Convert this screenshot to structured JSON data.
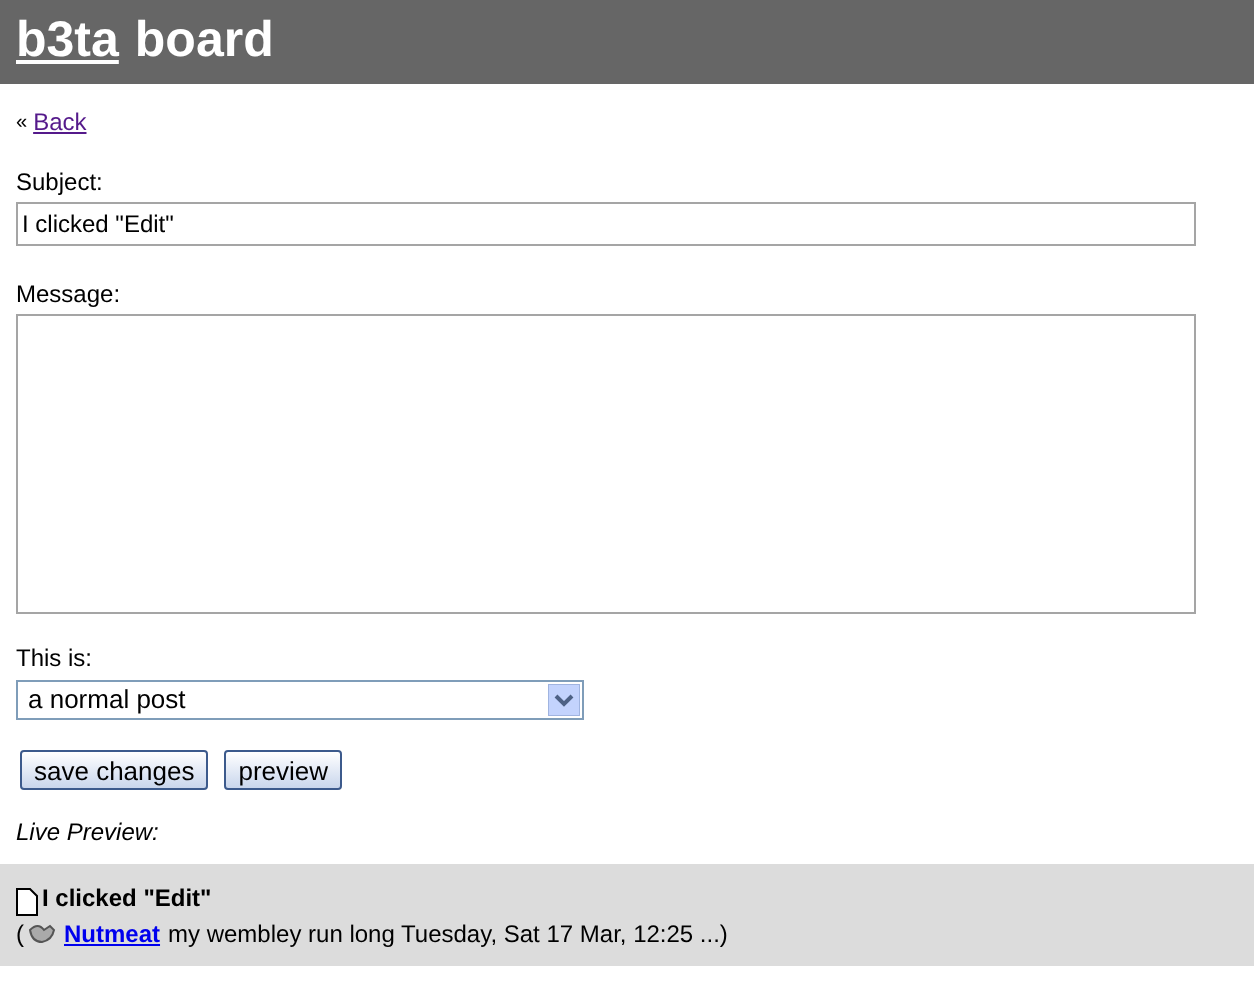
{
  "header": {
    "logo_link": "b3ta",
    "title": "board"
  },
  "back": {
    "prefix": "«",
    "link": "Back"
  },
  "subject": {
    "label": "Subject:",
    "value": "I clicked \"Edit\""
  },
  "message": {
    "label": "Message:"
  },
  "post_type": {
    "label": "This is:",
    "value": "a normal post"
  },
  "buttons": [
    "save changes",
    "preview"
  ],
  "preview": {
    "label": "Live Preview:",
    "title": "I clicked \"Edit\"",
    "open_paren": "(",
    "author": "Nutmeat",
    "details": "my wembley run long Tuesday, Sat 17 Mar, 12:25 ...)"
  }
}
